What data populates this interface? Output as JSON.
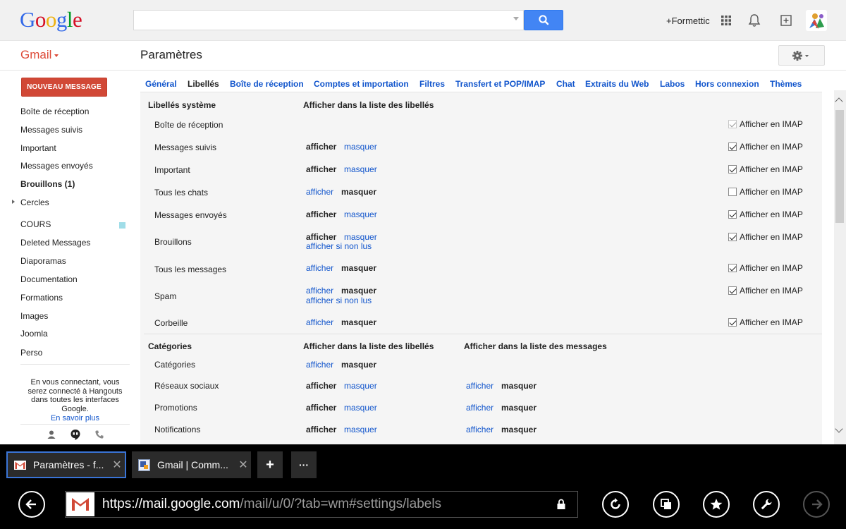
{
  "header": {
    "logo": {
      "G": "G",
      "o1": "o",
      "o2": "o",
      "g": "g",
      "l": "l",
      "e": "e"
    },
    "search": {
      "value": "",
      "placeholder": ""
    },
    "user_link": "+Formettic",
    "icons": [
      "apps-grid-icon",
      "bell-icon",
      "share-plus-icon",
      "avatar"
    ]
  },
  "toolbar": {
    "app_label": "Gmail",
    "page_title": "Paramètres"
  },
  "sidebar": {
    "compose_label": "NOUVEAU MESSAGE",
    "items": [
      {
        "label": "Boîte de réception",
        "bold": false
      },
      {
        "label": "Messages suivis",
        "bold": false
      },
      {
        "label": "Important",
        "bold": false
      },
      {
        "label": "Messages envoyés",
        "bold": false
      },
      {
        "label": "Brouillons (1)",
        "bold": true
      },
      {
        "label": "Cercles",
        "bold": false
      },
      {
        "label": "COURS",
        "bold": false
      },
      {
        "label": "Deleted Messages",
        "bold": false
      },
      {
        "label": "Diaporamas",
        "bold": false
      },
      {
        "label": "Documentation",
        "bold": false
      },
      {
        "label": "Formations",
        "bold": false
      },
      {
        "label": "Images",
        "bold": false
      },
      {
        "label": "Joomla",
        "bold": false
      },
      {
        "label": "Perso",
        "bold": false
      }
    ],
    "hangouts": {
      "text": "En vous connectant, vous serez connecté à Hangouts dans toutes les interfaces Google.",
      "link": "En savoir plus"
    }
  },
  "tabs": [
    "Général",
    "Libellés",
    "Boîte de réception",
    "Comptes et importation",
    "Filtres",
    "Transfert et POP/IMAP",
    "Chat",
    "Extraits du Web",
    "Labos",
    "Hors connexion",
    "Thèmes"
  ],
  "active_tab": "Libellés",
  "system_labels": {
    "header_name": "Libellés système",
    "header_show": "Afficher dans la liste des libellés",
    "imap_label": "Afficher en IMAP",
    "rows": [
      {
        "name": "Boîte de réception",
        "show": "",
        "hide": "",
        "unread": "",
        "visible": null,
        "imap": true,
        "imap_disabled": true
      },
      {
        "name": "Messages suivis",
        "show": "afficher",
        "hide": "masquer",
        "unread": "",
        "visible": true,
        "imap": true,
        "imap_disabled": false
      },
      {
        "name": "Important",
        "show": "afficher",
        "hide": "masquer",
        "unread": "",
        "visible": true,
        "imap": true,
        "imap_disabled": false
      },
      {
        "name": "Tous les chats",
        "show": "afficher",
        "hide": "masquer",
        "unread": "",
        "visible": false,
        "imap": false,
        "imap_disabled": false
      },
      {
        "name": "Messages envoyés",
        "show": "afficher",
        "hide": "masquer",
        "unread": "",
        "visible": true,
        "imap": true,
        "imap_disabled": false
      },
      {
        "name": "Brouillons",
        "show": "afficher",
        "hide": "masquer",
        "unread": "afficher si non lus",
        "visible": true,
        "imap": true,
        "imap_disabled": false
      },
      {
        "name": "Tous les messages",
        "show": "afficher",
        "hide": "masquer",
        "unread": "",
        "visible": false,
        "imap": true,
        "imap_disabled": false
      },
      {
        "name": "Spam",
        "show": "afficher",
        "hide": "masquer",
        "unread": "afficher si non lus",
        "visible": false,
        "imap": true,
        "imap_disabled": false
      },
      {
        "name": "Corbeille",
        "show": "afficher",
        "hide": "masquer",
        "unread": "",
        "visible": false,
        "imap": true,
        "imap_disabled": false
      }
    ]
  },
  "categories": {
    "header_name": "Catégories",
    "header_show": "Afficher dans la liste des libellés",
    "header_msgs": "Afficher dans la liste des messages",
    "rows": [
      {
        "name": "Catégories",
        "show": "afficher",
        "hide": "masquer",
        "visible": false,
        "msg_show": "",
        "msg_hide": "",
        "msg_visible": null
      },
      {
        "name": "Réseaux sociaux",
        "show": "afficher",
        "hide": "masquer",
        "visible": true,
        "msg_show": "afficher",
        "msg_hide": "masquer",
        "msg_visible": false
      },
      {
        "name": "Promotions",
        "show": "afficher",
        "hide": "masquer",
        "visible": true,
        "msg_show": "afficher",
        "msg_hide": "masquer",
        "msg_visible": false
      },
      {
        "name": "Notifications",
        "show": "afficher",
        "hide": "masquer",
        "visible": true,
        "msg_show": "afficher",
        "msg_hide": "masquer",
        "msg_visible": false
      }
    ]
  },
  "browser": {
    "tabs": [
      {
        "title": "Paramètres - f...",
        "close": "✕",
        "active": true
      },
      {
        "title": "Gmail | Comm...",
        "close": "✕",
        "active": false
      }
    ],
    "new_tab": "+",
    "more": "···",
    "url_host": "https://mail.google.com",
    "url_path": "/mail/u/0/?tab=wm#settings/labels"
  },
  "colors": {
    "link": "#1155cc",
    "compose": "#d14836",
    "search_button": "#4285f4",
    "gmail_red": "#dd4b39",
    "cours_label": "#a0dde8",
    "active_tab_border": "#3a74d6"
  }
}
